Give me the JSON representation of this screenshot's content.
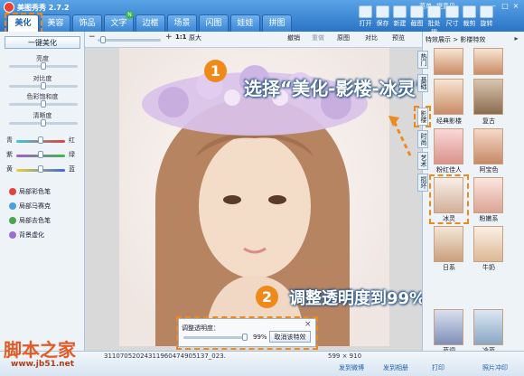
{
  "app": {
    "title": "美图秀秀 2.7.2"
  },
  "tabs": [
    {
      "label": "美化",
      "active": true
    },
    {
      "label": "美容",
      "active": false
    },
    {
      "label": "饰品",
      "active": false
    },
    {
      "label": "文字",
      "active": false
    },
    {
      "label": "边框",
      "active": false
    },
    {
      "label": "场景",
      "active": false
    },
    {
      "label": "闪图",
      "active": false
    },
    {
      "label": "娃娃",
      "active": false
    },
    {
      "label": "拼图",
      "active": false
    }
  ],
  "new_badge": "N",
  "top_links": {
    "menu": "菜单",
    "login": "提意见"
  },
  "window_buttons": {
    "min": "–",
    "max": "□",
    "close": "×"
  },
  "toolbar_tools": [
    {
      "label": "打开",
      "icon": "open-icon"
    },
    {
      "label": "保存",
      "icon": "save-icon"
    },
    {
      "label": "新建",
      "icon": "new-icon"
    },
    {
      "label": "截图",
      "icon": "screenshot-icon"
    },
    {
      "label": "批处理",
      "icon": "batch-icon"
    },
    {
      "label": "尺寸",
      "icon": "resize-icon"
    },
    {
      "label": "裁剪",
      "icon": "crop-icon"
    },
    {
      "label": "旋转",
      "icon": "rotate-icon"
    }
  ],
  "left_panel": {
    "beautify_button": "一键美化",
    "sliders": [
      {
        "label": "亮度",
        "value": 0.5
      },
      {
        "label": "对比度",
        "value": 0.5
      },
      {
        "label": "色彩饱和度",
        "value": 0.5
      },
      {
        "label": "清晰度",
        "value": 0.5
      }
    ],
    "color_sliders": [
      {
        "left": "青",
        "right": "红",
        "value": 0.5
      },
      {
        "left": "紫",
        "right": "绿",
        "value": 0.5
      },
      {
        "left": "黄",
        "right": "蓝",
        "value": 0.5
      }
    ],
    "brushes": [
      {
        "label": "局部彩色笔",
        "color": "#e4433a"
      },
      {
        "label": "局部马赛克",
        "color": "#4aa0e0"
      },
      {
        "label": "局部去色笔",
        "color": "#4aa64a"
      },
      {
        "label": "背景虚化",
        "color": "#9b6fd0"
      }
    ]
  },
  "canvas_toolbar": {
    "zoom_minus": "−",
    "zoom_plus": "+",
    "actual_size": "1:1",
    "fit": "原大",
    "undo": "撤销",
    "redo": "重做",
    "original": "原图",
    "compare": "对比",
    "preview": "预览"
  },
  "effect_panel": {
    "breadcrumb": "特效展示 > 影楼特效",
    "side_tabs": [
      "热门",
      "基础",
      "影楼",
      "时尚",
      "艺术",
      "损坏"
    ],
    "thumbnails": [
      {
        "label": ""
      },
      {
        "label": ""
      },
      {
        "label": "经典影楼"
      },
      {
        "label": "复古"
      },
      {
        "label": "粉红佳人"
      },
      {
        "label": "阿宝色"
      },
      {
        "label": "冰灵"
      },
      {
        "label": "粉嫩系"
      },
      {
        "label": "日系"
      },
      {
        "label": "牛奶"
      },
      {
        "label": "蓝调"
      },
      {
        "label": "冷蓝"
      }
    ]
  },
  "annotations": [
    {
      "number": "1",
      "text": "选择“美化-影楼-冰灵”"
    },
    {
      "number": "2",
      "text": "调整透明度到99%"
    }
  ],
  "opacity_popup": {
    "label": "调整透明度：",
    "value": "99%",
    "cancel": "取消该特效",
    "slider_value": 0.99,
    "close": "×"
  },
  "status": {
    "filename": "31107052024311960474905137_023.",
    "size": "599 × 910",
    "watermark_brand": "脚本之家",
    "watermark_url": "www.jb51.net",
    "links": [
      "发到微博",
      "发到相册",
      "打印",
      "照片冲印"
    ]
  }
}
